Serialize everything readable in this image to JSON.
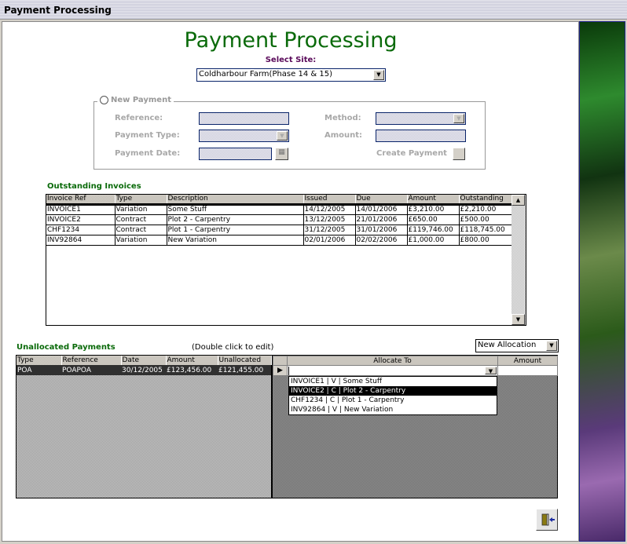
{
  "window": {
    "title": "Payment Processing"
  },
  "header": {
    "title": "Payment Processing",
    "select_site_label": "Select Site:",
    "site_value": "Coldharbour Farm(Phase 14 & 15)"
  },
  "new_payment": {
    "label": "New Payment",
    "reference_label": "Reference:",
    "payment_type_label": "Payment Type:",
    "payment_date_label": "Payment Date:",
    "method_label": "Method:",
    "amount_label": "Amount:",
    "create_payment_label": "Create Payment"
  },
  "invoices": {
    "title": "Outstanding Invoices",
    "columns": [
      "Invoice Ref",
      "Type",
      "Description",
      "Issued",
      "Due",
      "Amount",
      "Outstanding"
    ],
    "rows": [
      [
        "INVOICE1",
        "Variation",
        "Some Stuff",
        "14/12/2005",
        "14/01/2006",
        "£3,210.00",
        "£2,210.00"
      ],
      [
        "INVOICE2",
        "Contract",
        "Plot 2 - Carpentry",
        "13/12/2005",
        "21/01/2006",
        "£650.00",
        "£500.00"
      ],
      [
        "CHF1234",
        "Contract",
        "Plot 1 - Carpentry",
        "31/12/2005",
        "31/01/2006",
        "£119,746.00",
        "£118,745.00"
      ],
      [
        "INV92864",
        "Variation",
        "New Variation",
        "02/01/2006",
        "02/02/2006",
        "£1,000.00",
        "£800.00"
      ]
    ]
  },
  "payments": {
    "title": "Unallocated Payments",
    "hint": "(Double click to edit)",
    "columns": [
      "Type",
      "Reference",
      "Date",
      "Amount",
      "Unallocated"
    ],
    "rows": [
      [
        "POA",
        "POAPOA",
        "30/12/2005",
        "£123,456.00",
        "£121,455.00"
      ]
    ]
  },
  "allocation": {
    "mode_value": "New Allocation",
    "columns": [
      "Allocate To",
      "Amount"
    ],
    "allocate_value": "",
    "options": [
      "INVOICE1 | V | Some Stuff",
      "INVOICE2 | C | Plot 2 - Carpentry",
      "CHF1234 | C | Plot 1 - Carpentry",
      "INV92864 | V | New Variation"
    ],
    "selected_index": 1
  }
}
